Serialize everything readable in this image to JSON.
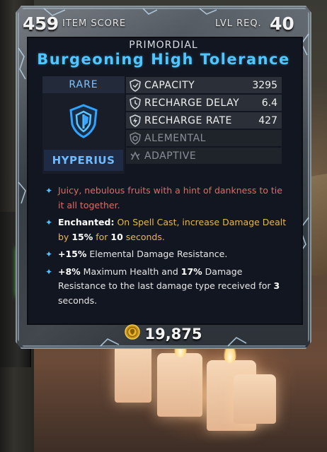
{
  "header": {
    "item_score": "459",
    "item_score_label": "ITEM SCORE",
    "level_req_label": "LVL REQ.",
    "level_req": "40"
  },
  "item": {
    "prefix": "PRIMORDIAL",
    "name": "Burgeoning High Tolerance",
    "rarity": "RARE",
    "manufacturer": "HYPERIUS",
    "icon": "shield-icon",
    "name_color": "#4fc6ff"
  },
  "stats": [
    {
      "label": "CAPACITY",
      "value": "3295",
      "icon": "capacity-icon",
      "active": true
    },
    {
      "label": "RECHARGE DELAY",
      "value": "6.4",
      "icon": "recharge-delay-icon",
      "active": true
    },
    {
      "label": "RECHARGE RATE",
      "value": "427",
      "icon": "recharge-rate-icon",
      "active": true
    },
    {
      "label": "ALEMENTAL",
      "value": "",
      "icon": "alemental-icon",
      "active": false
    },
    {
      "label": "ADAPTIVE",
      "value": "",
      "icon": "adaptive-icon",
      "active": false
    }
  ],
  "description": {
    "flavor": "Juicy, nebulous fruits with a hint of dankness to tie it all together.",
    "enchant_label": "Enchanted:",
    "enchant_pre": " On Spell Cast, increase Damage Dealt by ",
    "enchant_pct": "15%",
    "enchant_mid": " for ",
    "enchant_secs": "10",
    "enchant_post": " seconds.",
    "perk1_val": "+15%",
    "perk1_text": " Elemental Damage Resistance.",
    "perk2_val1": "+8%",
    "perk2_mid": " Maximum Health and ",
    "perk2_val2": "17%",
    "perk2_text": " Damage Resistance to the last damage type received for ",
    "perk2_secs": "3",
    "perk2_post": " seconds."
  },
  "price": {
    "value": "19,875",
    "icon": "coin-icon"
  },
  "colors": {
    "accent": "#4fc3ff",
    "flavor": "#e06a66",
    "enchant": "#e8b84a"
  }
}
